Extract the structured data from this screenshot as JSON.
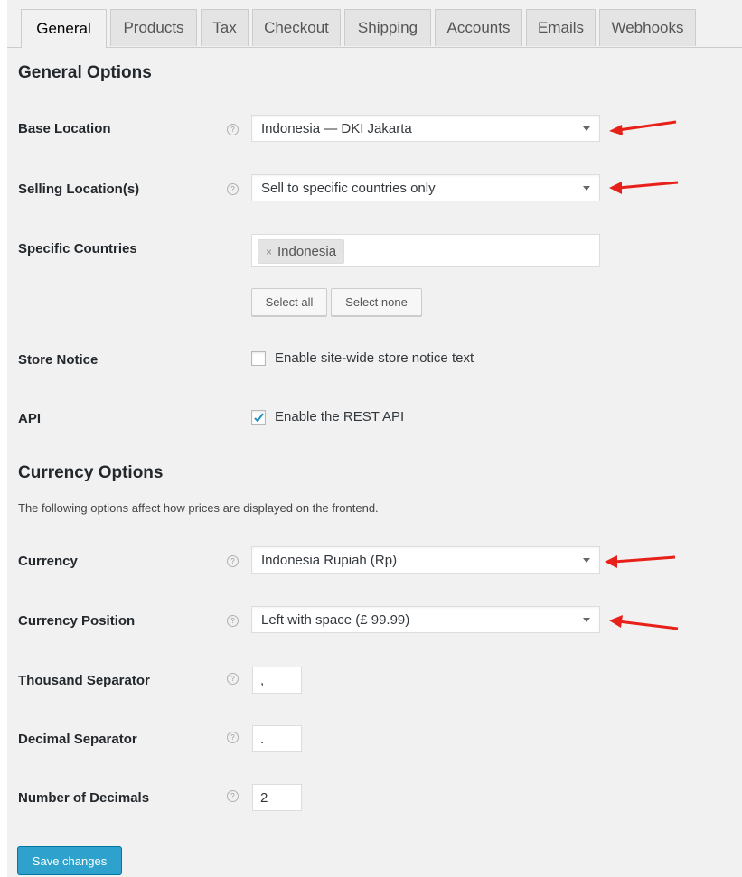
{
  "tabs": [
    {
      "label": "General",
      "active": true
    },
    {
      "label": "Products"
    },
    {
      "label": "Tax"
    },
    {
      "label": "Checkout"
    },
    {
      "label": "Shipping"
    },
    {
      "label": "Accounts"
    },
    {
      "label": "Emails"
    },
    {
      "label": "Webhooks"
    }
  ],
  "general": {
    "title": "General Options",
    "base_location": {
      "label": "Base Location",
      "value": "Indonesia — DKI Jakarta"
    },
    "selling_locations": {
      "label": "Selling Location(s)",
      "value": "Sell to specific countries only"
    },
    "specific_countries": {
      "label": "Specific Countries",
      "tokens": [
        "Indonesia"
      ],
      "remove_glyph": "×"
    },
    "select_all_label": "Select all",
    "select_none_label": "Select none",
    "store_notice": {
      "label": "Store Notice",
      "checkbox_label": "Enable site-wide store notice text",
      "checked": false
    },
    "api": {
      "label": "API",
      "checkbox_label": "Enable the REST API",
      "checked": true
    }
  },
  "currency": {
    "title": "Currency Options",
    "description": "The following options affect how prices are displayed on the frontend.",
    "currency": {
      "label": "Currency",
      "value": "Indonesia Rupiah (Rp)"
    },
    "position": {
      "label": "Currency Position",
      "value": "Left with space (£ 99.99)"
    },
    "thousand_sep": {
      "label": "Thousand Separator",
      "value": ","
    },
    "decimal_sep": {
      "label": "Decimal Separator",
      "value": "."
    },
    "decimals": {
      "label": "Number of Decimals",
      "value": "2"
    }
  },
  "help_glyph": "?",
  "save_label": "Save changes",
  "colors": {
    "annotation_arrow": "#e8201a",
    "primary_button": "#2ea2cc",
    "panel_bg": "#f1f1f1"
  },
  "icons": {
    "help": "help-icon",
    "caret": "caret-down-icon",
    "check": "checkmark-icon",
    "arrow": "annotation-arrow-icon"
  }
}
